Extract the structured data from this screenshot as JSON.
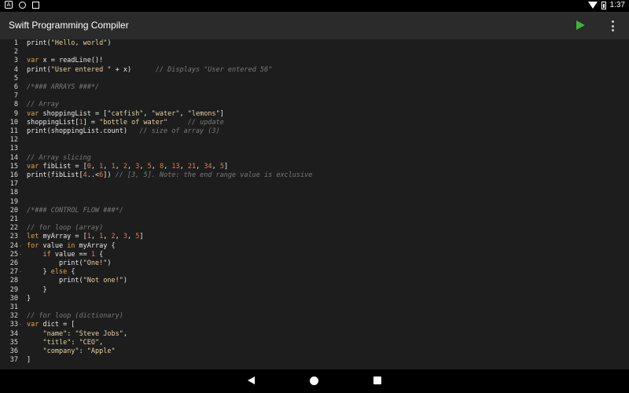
{
  "status_bar": {
    "time": "1:37"
  },
  "app_bar": {
    "title": "Swift Programming Compiler"
  },
  "colors": {
    "keyword": "#e1a54a",
    "string": "#e6d2a0",
    "number": "#e07d5a",
    "comment": "#7a7a7a",
    "plain": "#e8e8e8",
    "run": "#3cb43c"
  },
  "editor": {
    "lines": [
      {
        "n": "1",
        "fold": "",
        "tokens": [
          [
            "plain",
            "print("
          ],
          [
            "str",
            "\"Hello, world\""
          ],
          [
            "plain",
            ")"
          ]
        ]
      },
      {
        "n": "2",
        "fold": "",
        "tokens": []
      },
      {
        "n": "3",
        "fold": "",
        "tokens": [
          [
            "kw",
            "var"
          ],
          [
            "plain",
            " x = readLine()!"
          ]
        ]
      },
      {
        "n": "4",
        "fold": "",
        "tokens": [
          [
            "plain",
            "print("
          ],
          [
            "str",
            "\"User entered \""
          ],
          [
            "plain",
            " + x)      "
          ],
          [
            "com",
            "// Displays \"User entered 56\""
          ]
        ]
      },
      {
        "n": "5",
        "fold": "",
        "tokens": []
      },
      {
        "n": "6",
        "fold": "",
        "tokens": [
          [
            "com",
            "/*### ARRAYS ###*/"
          ]
        ]
      },
      {
        "n": "7",
        "fold": "",
        "tokens": []
      },
      {
        "n": "8",
        "fold": "",
        "tokens": [
          [
            "com",
            "// Array"
          ]
        ]
      },
      {
        "n": "9",
        "fold": "",
        "tokens": [
          [
            "kw",
            "var"
          ],
          [
            "plain",
            " shoppingList = ["
          ],
          [
            "str",
            "\"catfish\""
          ],
          [
            "plain",
            ", "
          ],
          [
            "str",
            "\"water\""
          ],
          [
            "plain",
            ", "
          ],
          [
            "str",
            "\"lemons\""
          ],
          [
            "plain",
            "]"
          ]
        ]
      },
      {
        "n": "10",
        "fold": "",
        "tokens": [
          [
            "plain",
            "shoppingList["
          ],
          [
            "num",
            "1"
          ],
          [
            "plain",
            "] = "
          ],
          [
            "str",
            "\"bottle of water\""
          ],
          [
            "plain",
            "     "
          ],
          [
            "com",
            "// update"
          ]
        ]
      },
      {
        "n": "11",
        "fold": "",
        "tokens": [
          [
            "plain",
            "print(shoppingList.count)   "
          ],
          [
            "com",
            "// size of array (3)"
          ]
        ]
      },
      {
        "n": "12",
        "fold": "",
        "tokens": []
      },
      {
        "n": "13",
        "fold": "",
        "tokens": []
      },
      {
        "n": "14",
        "fold": "",
        "tokens": [
          [
            "com",
            "// Array slicing"
          ]
        ]
      },
      {
        "n": "15",
        "fold": "",
        "tokens": [
          [
            "kw",
            "var"
          ],
          [
            "plain",
            " fibList = ["
          ],
          [
            "num",
            "0"
          ],
          [
            "plain",
            ", "
          ],
          [
            "num",
            "1"
          ],
          [
            "plain",
            ", "
          ],
          [
            "num",
            "1"
          ],
          [
            "plain",
            ", "
          ],
          [
            "num",
            "2"
          ],
          [
            "plain",
            ", "
          ],
          [
            "num",
            "3"
          ],
          [
            "plain",
            ", "
          ],
          [
            "num",
            "5"
          ],
          [
            "plain",
            ", "
          ],
          [
            "num",
            "8"
          ],
          [
            "plain",
            ", "
          ],
          [
            "num",
            "13"
          ],
          [
            "plain",
            ", "
          ],
          [
            "num",
            "21"
          ],
          [
            "plain",
            ", "
          ],
          [
            "num",
            "34"
          ],
          [
            "plain",
            ", "
          ],
          [
            "num",
            "5"
          ],
          [
            "plain",
            "]"
          ]
        ]
      },
      {
        "n": "16",
        "fold": "",
        "tokens": [
          [
            "plain",
            "print(fibList["
          ],
          [
            "num",
            "4"
          ],
          [
            "plain",
            "..<"
          ],
          [
            "num",
            "6"
          ],
          [
            "plain",
            "]) "
          ],
          [
            "com",
            "// [3, 5]. Note: the end range value is exclusive"
          ]
        ]
      },
      {
        "n": "17",
        "fold": "",
        "tokens": []
      },
      {
        "n": "18",
        "fold": "",
        "tokens": []
      },
      {
        "n": "19",
        "fold": "",
        "tokens": []
      },
      {
        "n": "20",
        "fold": "",
        "tokens": [
          [
            "com",
            "/*### CONTROL FLOW ###*/"
          ]
        ]
      },
      {
        "n": "21",
        "fold": "",
        "tokens": []
      },
      {
        "n": "22",
        "fold": "",
        "tokens": [
          [
            "com",
            "// for loop (array)"
          ]
        ]
      },
      {
        "n": "23",
        "fold": "",
        "tokens": [
          [
            "kw",
            "let"
          ],
          [
            "plain",
            " myArray = ["
          ],
          [
            "num",
            "1"
          ],
          [
            "plain",
            ", "
          ],
          [
            "num",
            "1"
          ],
          [
            "plain",
            ", "
          ],
          [
            "num",
            "2"
          ],
          [
            "plain",
            ", "
          ],
          [
            "num",
            "3"
          ],
          [
            "plain",
            ", "
          ],
          [
            "num",
            "5"
          ],
          [
            "plain",
            "]"
          ]
        ]
      },
      {
        "n": "24",
        "fold": "-",
        "tokens": [
          [
            "kw",
            "for"
          ],
          [
            "plain",
            " value "
          ],
          [
            "kw",
            "in"
          ],
          [
            "plain",
            " myArray {"
          ]
        ]
      },
      {
        "n": "25",
        "fold": "-",
        "tokens": [
          [
            "plain",
            "    "
          ],
          [
            "kw",
            "if"
          ],
          [
            "plain",
            " value == "
          ],
          [
            "num",
            "1"
          ],
          [
            "plain",
            " {"
          ]
        ]
      },
      {
        "n": "26",
        "fold": "",
        "tokens": [
          [
            "plain",
            "        print("
          ],
          [
            "str",
            "\"One!\""
          ],
          [
            "plain",
            ")"
          ]
        ]
      },
      {
        "n": "27",
        "fold": "-",
        "tokens": [
          [
            "plain",
            "    } "
          ],
          [
            "kw",
            "else"
          ],
          [
            "plain",
            " {"
          ]
        ]
      },
      {
        "n": "28",
        "fold": "",
        "tokens": [
          [
            "plain",
            "        print("
          ],
          [
            "str",
            "\"Not one!\""
          ],
          [
            "plain",
            ")"
          ]
        ]
      },
      {
        "n": "29",
        "fold": "",
        "tokens": [
          [
            "plain",
            "    }"
          ]
        ]
      },
      {
        "n": "30",
        "fold": "",
        "tokens": [
          [
            "plain",
            "}"
          ]
        ]
      },
      {
        "n": "31",
        "fold": "",
        "tokens": []
      },
      {
        "n": "32",
        "fold": "",
        "tokens": [
          [
            "com",
            "// for loop (dictionary)"
          ]
        ]
      },
      {
        "n": "33",
        "fold": "-",
        "tokens": [
          [
            "kw",
            "var"
          ],
          [
            "plain",
            " dict = ["
          ]
        ]
      },
      {
        "n": "34",
        "fold": "",
        "tokens": [
          [
            "plain",
            "    "
          ],
          [
            "str",
            "\"name\""
          ],
          [
            "plain",
            ": "
          ],
          [
            "str",
            "\"Steve Jobs\""
          ],
          [
            "plain",
            ","
          ]
        ]
      },
      {
        "n": "35",
        "fold": "",
        "tokens": [
          [
            "plain",
            "    "
          ],
          [
            "str",
            "\"title\""
          ],
          [
            "plain",
            ": "
          ],
          [
            "str",
            "\"CEO\""
          ],
          [
            "plain",
            ","
          ]
        ]
      },
      {
        "n": "36",
        "fold": "",
        "tokens": [
          [
            "plain",
            "    "
          ],
          [
            "str",
            "\"company\""
          ],
          [
            "plain",
            ": "
          ],
          [
            "str",
            "\"Apple\""
          ]
        ]
      },
      {
        "n": "37",
        "fold": "",
        "tokens": [
          [
            "plain",
            "]"
          ]
        ]
      }
    ]
  }
}
